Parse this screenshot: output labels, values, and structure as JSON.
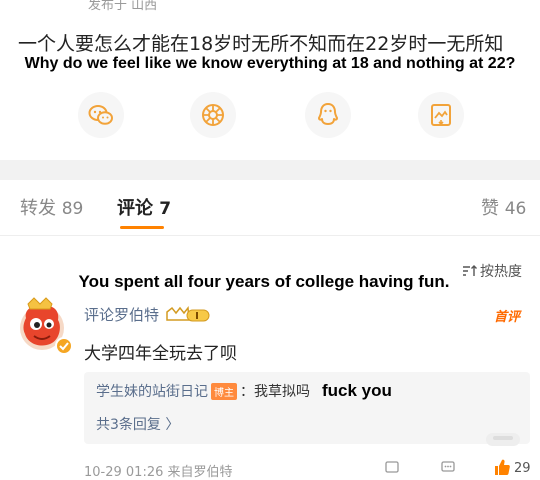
{
  "post": {
    "meta": "发布于 山西",
    "title": "一个人要怎么才能在18岁时无所不知而在22岁时一无所知",
    "translation": "Why do we feel like we know everything at 18 and nothing at 22?"
  },
  "share_buttons": [
    {
      "icon": "wechat-icon",
      "color": "#f2a33a"
    },
    {
      "icon": "moments-icon",
      "color": "#f2a33a"
    },
    {
      "icon": "qq-icon",
      "color": "#f2a33a"
    },
    {
      "icon": "save-image-icon",
      "color": "#f2a33a"
    }
  ],
  "tabs": {
    "repost": {
      "label": "转发",
      "count": "89"
    },
    "comments": {
      "label": "评论",
      "count": "7"
    },
    "likes": {
      "label": "赞",
      "count": "46"
    }
  },
  "sort_label": "按热度",
  "comment": {
    "overlay_translation": "You spent all four years of college having fun.",
    "author": "评论罗伯特",
    "hot_label": "首评",
    "text": "大学四年全玩去了呗",
    "reply": {
      "user": "学生妹的站街日记",
      "badge": "博主",
      "colon": "：",
      "text": "我草拟吗",
      "translation": "fuck you"
    },
    "more_replies": "共3条回复 〉",
    "timestamp": "10-29 01:26  来自罗伯特",
    "like_count": "29"
  },
  "colors": {
    "accent": "#ff8200",
    "link": "#5a6e8c",
    "badge": "#ff8a3d"
  }
}
